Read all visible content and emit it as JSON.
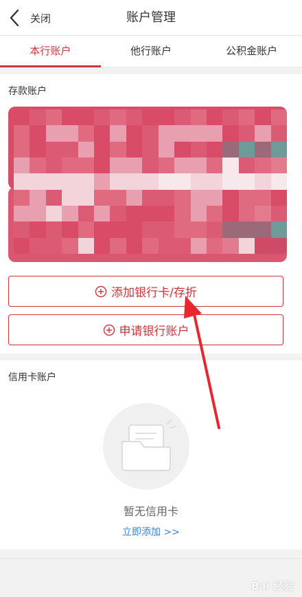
{
  "navbar": {
    "back_label": "关闭",
    "title": "账户管理"
  },
  "tabs": [
    {
      "label": "本行账户",
      "active": true
    },
    {
      "label": "他行账户",
      "active": false
    },
    {
      "label": "公积金账户",
      "active": false
    }
  ],
  "deposit": {
    "section_title": "存款账户",
    "add_button_label": "添加银行卡/存折",
    "apply_button_label": "申请银行账户"
  },
  "credit": {
    "section_title": "信用卡账户",
    "empty_text": "暂无信用卡",
    "add_link": "立即添加 >>"
  },
  "watermark": "Bai 经验",
  "colors": {
    "accent": "#d0343c",
    "link": "#3d7fd6",
    "card": "#d84c68",
    "mosaic": [
      "#d84c68",
      "#e06a80",
      "#e8a0b0",
      "#f2d4da",
      "#db5a74",
      "#9a6a78",
      "#6f9a9a",
      "#e37b8e",
      "#f7e8ec",
      "#cf4a66"
    ]
  },
  "icons": {
    "back": "chevron-left-icon",
    "plus": "plus-circle-icon",
    "empty": "empty-folder-icon"
  }
}
